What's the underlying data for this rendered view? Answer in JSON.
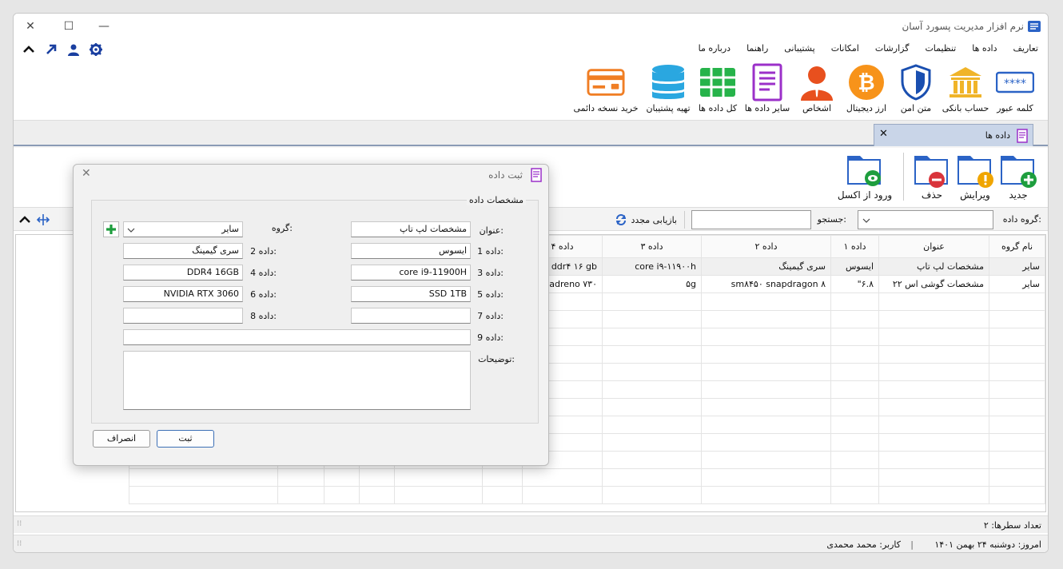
{
  "app": {
    "title": "نرم افزار مدیریت پسورد آسان"
  },
  "menu": [
    "تعاریف",
    "داده ها",
    "تنظیمات",
    "گزارشات",
    "امکانات",
    "پشتیبانی",
    "راهنما",
    "درباره ما"
  ],
  "quick_icons": [
    "gear-icon",
    "user-icon",
    "arrow-up-right-icon",
    "chevron-up-icon"
  ],
  "ribbon": [
    {
      "label": "کلمه عبور",
      "icon": "password-icon"
    },
    {
      "label": "حساب بانکی",
      "icon": "bank-icon"
    },
    {
      "label": "متن امن",
      "icon": "shield-icon"
    },
    {
      "label": "ارز دیجیتال",
      "icon": "bitcoin-icon"
    },
    {
      "label": "اشخاص",
      "icon": "person-icon"
    },
    {
      "label": "سایر داده ها",
      "icon": "document-icon"
    },
    {
      "label": "کل داده ها",
      "icon": "grid-icon"
    },
    {
      "label": "تهیه پشتیبان",
      "icon": "database-icon"
    },
    {
      "label": "خرید نسخه دائمی",
      "icon": "credit-card-icon"
    }
  ],
  "doc_tab": {
    "label": "داده ها"
  },
  "toolbar": {
    "new": "جدید",
    "edit": "ویرایش",
    "delete": "حذف",
    "import_excel": "ورود از اکسل"
  },
  "filter": {
    "group_label": "گروه داده:",
    "search_label": "جستجو:",
    "refresh_label": "بازیابی مجدد"
  },
  "grid": {
    "columns": [
      "نام گروه",
      "عنوان",
      "داده ۱",
      "داده ۲",
      "داده ۳",
      "داده ۴"
    ],
    "rows": [
      [
        "سایر",
        "مشخصات لپ تاپ",
        "ایسوس",
        "سری گیمینگ",
        "core i۹-۱۱۹۰۰h",
        "ddr۴ ۱۶ gb"
      ],
      [
        "سایر",
        "مشخصات گوشی اس ۲۲",
        "۶.۸\"",
        "sm۸۴۵۰ snapdragon ۸",
        "۵g",
        "adreno ۷۳۰"
      ]
    ]
  },
  "status": {
    "row_count": "تعداد سطرها:  ۲",
    "today": "امروز: دوشنبه ۲۴ بهمن ۱۴۰۱",
    "user": "کاربر: محمد محمدی"
  },
  "dialog": {
    "title": "ثبت داده",
    "group_title": "مشخصات داده",
    "fields": {
      "title_label": "عنوان:",
      "title_value": "مشخصات لپ تاپ",
      "group_label": "گروه:",
      "group_value": "سایر",
      "d1_label": "داده 1:",
      "d1_value": "ایسوس",
      "d2_label": "داده 2:",
      "d2_value": "سری گیمینگ",
      "d3_label": "داده 3:",
      "d3_value": "core i9-11900H",
      "d4_label": "داده 4:",
      "d4_value": "DDR4 16GB",
      "d5_label": "داده 5:",
      "d5_value": "SSD 1TB",
      "d6_label": "داده 6:",
      "d6_value": "NVIDIA RTX 3060",
      "d7_label": "داده 7:",
      "d7_value": "",
      "d8_label": "داده 8:",
      "d8_value": "",
      "d9_label": "داده 9:",
      "d9_value": "",
      "desc_label": "توضیحات:",
      "desc_value": ""
    },
    "save": "ثبت",
    "cancel": "انصراف"
  },
  "colors": {
    "accent_blue": "#2b63c6",
    "green": "#1e9e3e",
    "red": "#d9343b",
    "orange": "#f39c12",
    "purple": "#9b30c9",
    "gold": "#f0b429"
  }
}
